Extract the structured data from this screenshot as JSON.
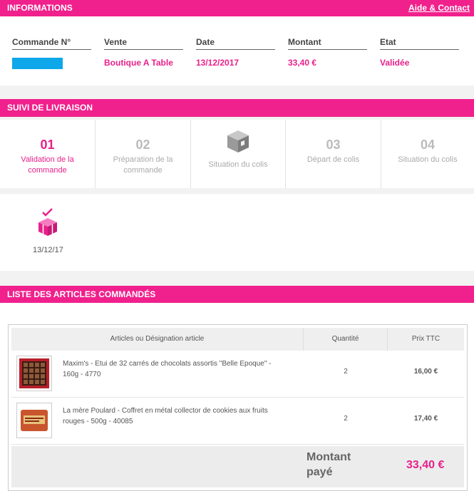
{
  "info": {
    "title": "INFORMATIONS",
    "help_link": "Aide & Contact",
    "headers": [
      "Commande N°",
      "Vente",
      "Date",
      "Montant",
      "Etat"
    ],
    "values": [
      "",
      "Boutique A Table",
      "13/12/2017",
      "33,40 €",
      "Validée"
    ]
  },
  "tracking": {
    "title": "SUIVI DE LIVRAISON",
    "steps": [
      {
        "num": "01",
        "label": "Validation de la commande"
      },
      {
        "num": "02",
        "label": "Préparation de la commande"
      },
      {
        "num": "",
        "label": "Situation du colis"
      },
      {
        "num": "03",
        "label": "Départ de colis"
      },
      {
        "num": "04",
        "label": "Situation du colis"
      }
    ],
    "event_date": "13/12/17"
  },
  "articles": {
    "title": "LISTE DES ARTICLES COMMANDÉS",
    "columns": [
      "Articles ou Désignation article",
      "Quantité",
      "Prix TTC"
    ],
    "rows": [
      {
        "desc": "Maxim's - Etui de 32 carrés de chocolats assortis \"Belle Epoque\" - 160g - 4770",
        "qty": "2",
        "price": "16,00 €"
      },
      {
        "desc": "La mère Poulard - Coffret en métal collector de cookies aux fruits rouges - 500g - 40085",
        "qty": "2",
        "price": "17,40 €"
      }
    ],
    "total_label": "Montant payé",
    "total_value": "33,40 €"
  },
  "colors": {
    "brand": "#f0208c",
    "accent_text": "#e8208a"
  },
  "icons": [
    "package-icon",
    "gift-box-check-icon"
  ]
}
